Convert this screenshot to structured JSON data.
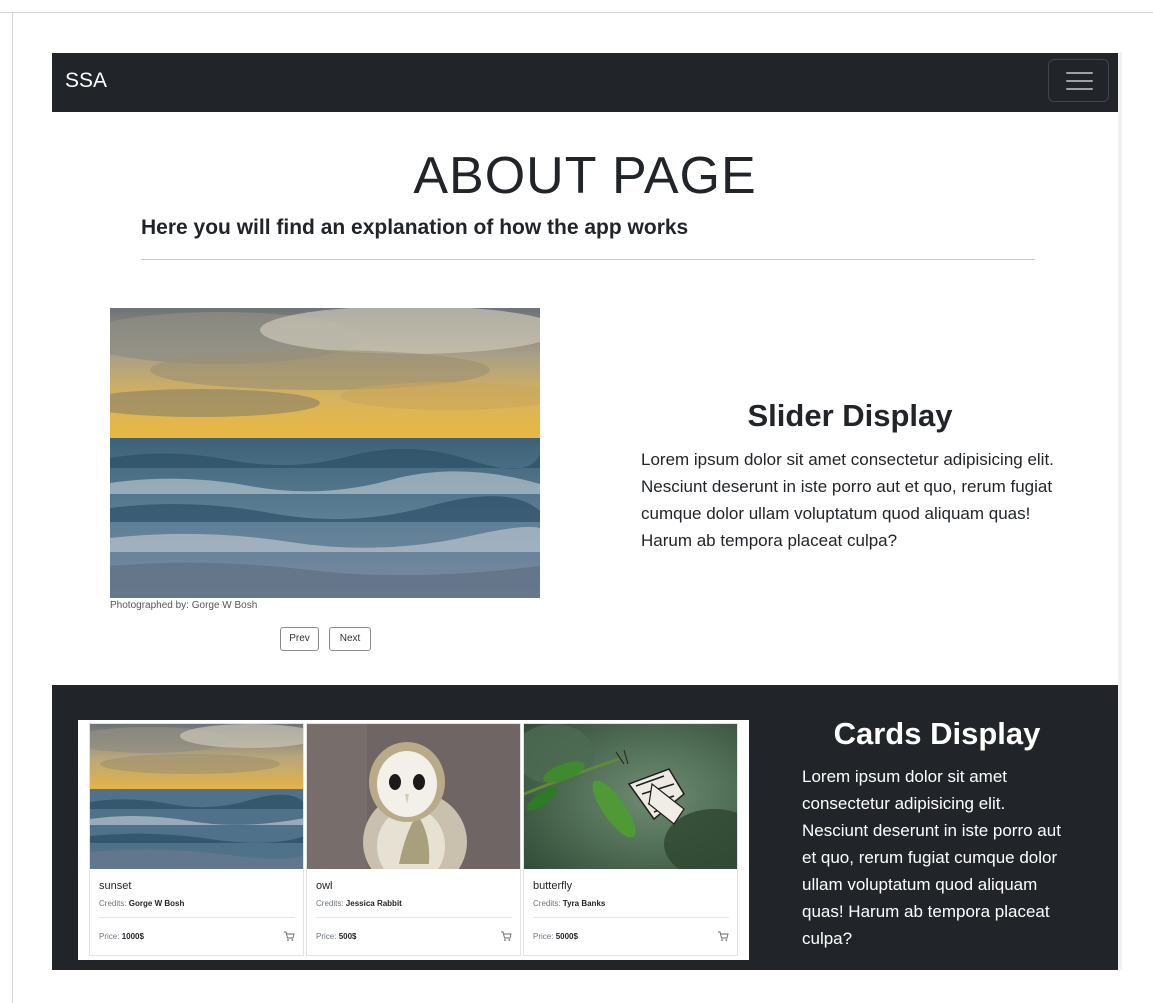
{
  "navbar": {
    "brand": "SSA",
    "menu_icon": "hamburger-menu-icon"
  },
  "header": {
    "title": "ABOUT PAGE",
    "subtitle": "Here you will find an explanation of how the app works"
  },
  "slider": {
    "image": "ocean-sunset-image",
    "caption": "Photographed by: Gorge W Bosh",
    "prev_label": "Prev",
    "next_label": "Next",
    "heading": "Slider Display",
    "text": "Lorem ipsum dolor sit amet consectetur adipisicing elit. Nesciunt deserunt in iste porro aut et quo, rerum fugiat cumque dolor ullam voluptatum quod aliquam quas! Harum ab tempora placeat culpa?"
  },
  "cards_section": {
    "heading": "Cards Display",
    "text": "Lorem ipsum dolor sit amet consectetur adipisicing elit. Nesciunt deserunt in iste porro aut et quo, rerum fugiat cumque dolor ullam voluptatum quod aliquam quas! Harum ab tempora placeat culpa?",
    "credits_label": "Credits:",
    "price_label": "Price:",
    "cards": [
      {
        "title": "sunset",
        "credits": "Gorge W Bosh",
        "price": "1000$",
        "image": "sunset-image",
        "icon": "cart-icon"
      },
      {
        "title": "owl",
        "credits": "Jessica Rabbit",
        "price": "500$",
        "image": "owl-image",
        "icon": "cart-icon"
      },
      {
        "title": "butterfly",
        "credits": "Tyra Banks",
        "price": "5000$",
        "image": "butterfly-image",
        "icon": "cart-icon"
      }
    ]
  },
  "colors": {
    "navbar_bg": "#212529",
    "section_dark_bg": "#212529",
    "text": "#212529"
  }
}
